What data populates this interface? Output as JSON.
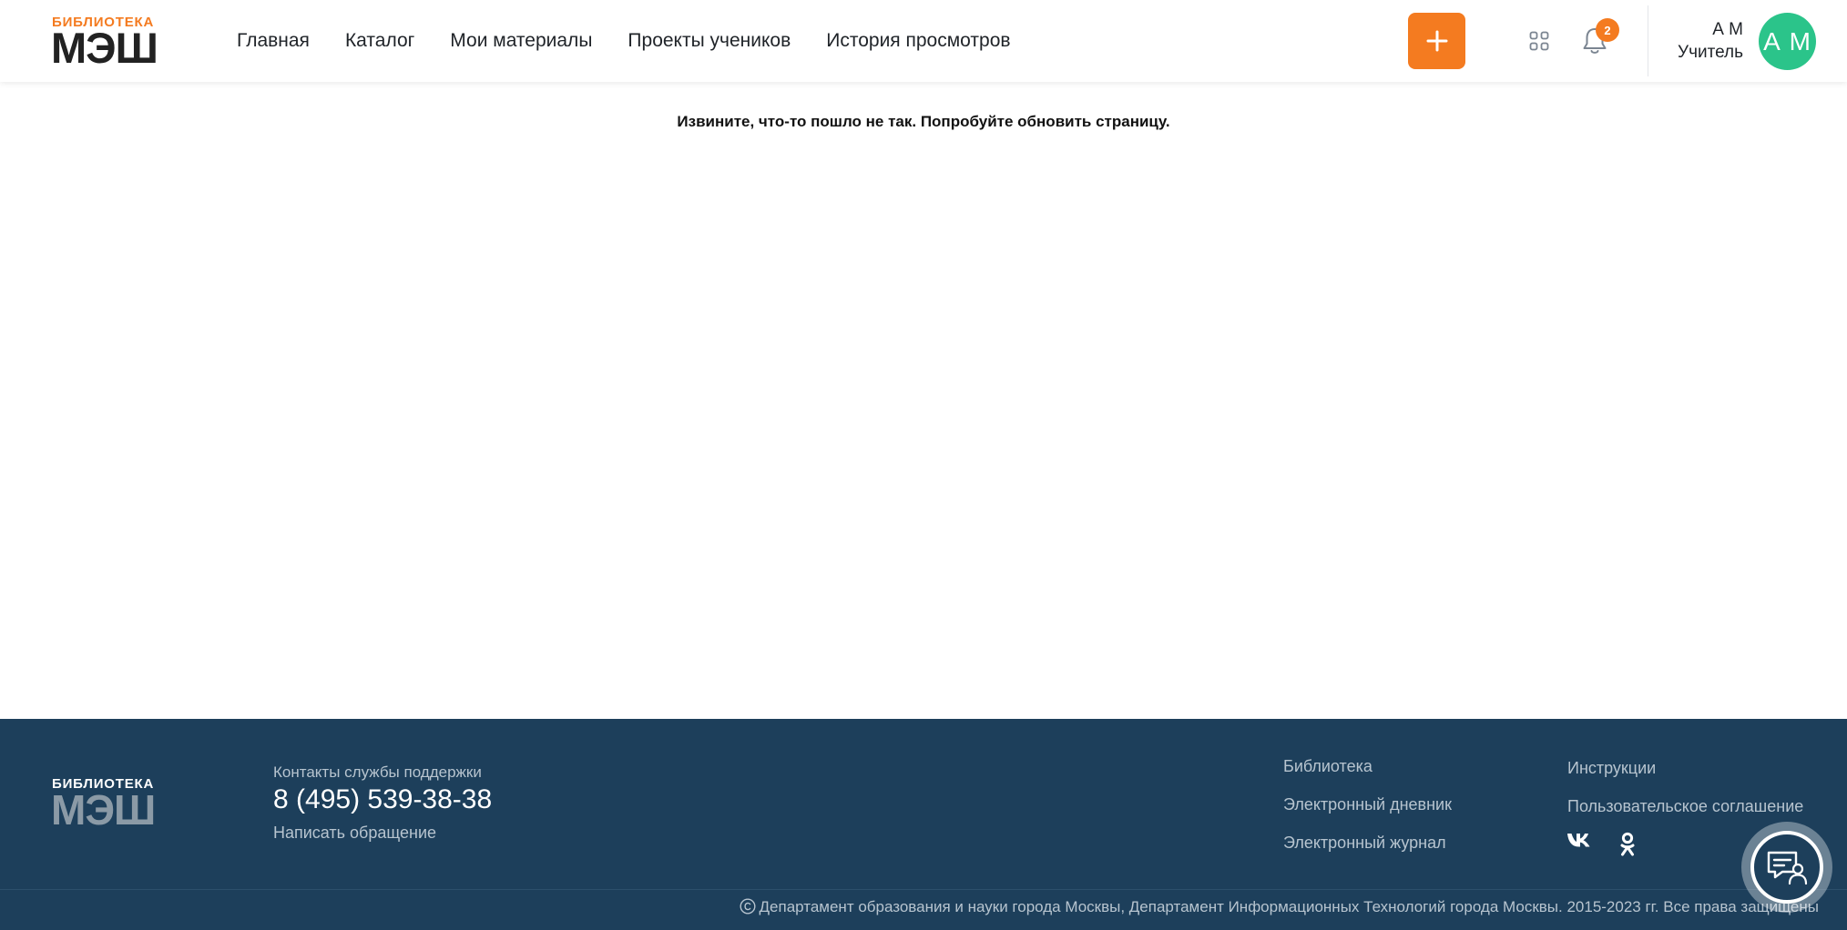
{
  "header": {
    "logo_small": "БИБЛИОТЕКА",
    "logo_big": "МЭШ",
    "nav": [
      "Главная",
      "Каталог",
      "Мои материалы",
      "Проекты учеников",
      "История просмотров"
    ],
    "add_icon": "plus-icon",
    "apps_icon": "apps-grid-icon",
    "bell_icon": "bell-icon",
    "notification_count": "2",
    "user_name": "А М",
    "user_role": "Учитель",
    "avatar_initials": "А М"
  },
  "main": {
    "error_message": "Извините, что-то пошло не так. Попробуйте обновить страницу."
  },
  "footer": {
    "logo_small": "БИБЛИОТЕКА",
    "logo_big": "МЭШ",
    "support_label": "Контакты службы поддержки",
    "support_phone": "8 (495) 539-38-38",
    "support_write": "Написать обращение",
    "links_col1": [
      "Библиотека",
      "Электронный дневник",
      "Электронный журнал"
    ],
    "links_col2": [
      "Инструкции",
      "Пользовательское соглашение"
    ],
    "social_icons": [
      "vk-icon",
      "odnoklassniki-icon"
    ],
    "copyright": "Департамент образования и науки города Москвы, Департамент Информационных Технологий города Москвы. 2015-2023 гг. Все права защищены",
    "help_icon": "support-chat-icon"
  },
  "colors": {
    "accent": "#f47b20",
    "avatar": "#2bc48a",
    "footer_bg": "#1d3f5b"
  }
}
